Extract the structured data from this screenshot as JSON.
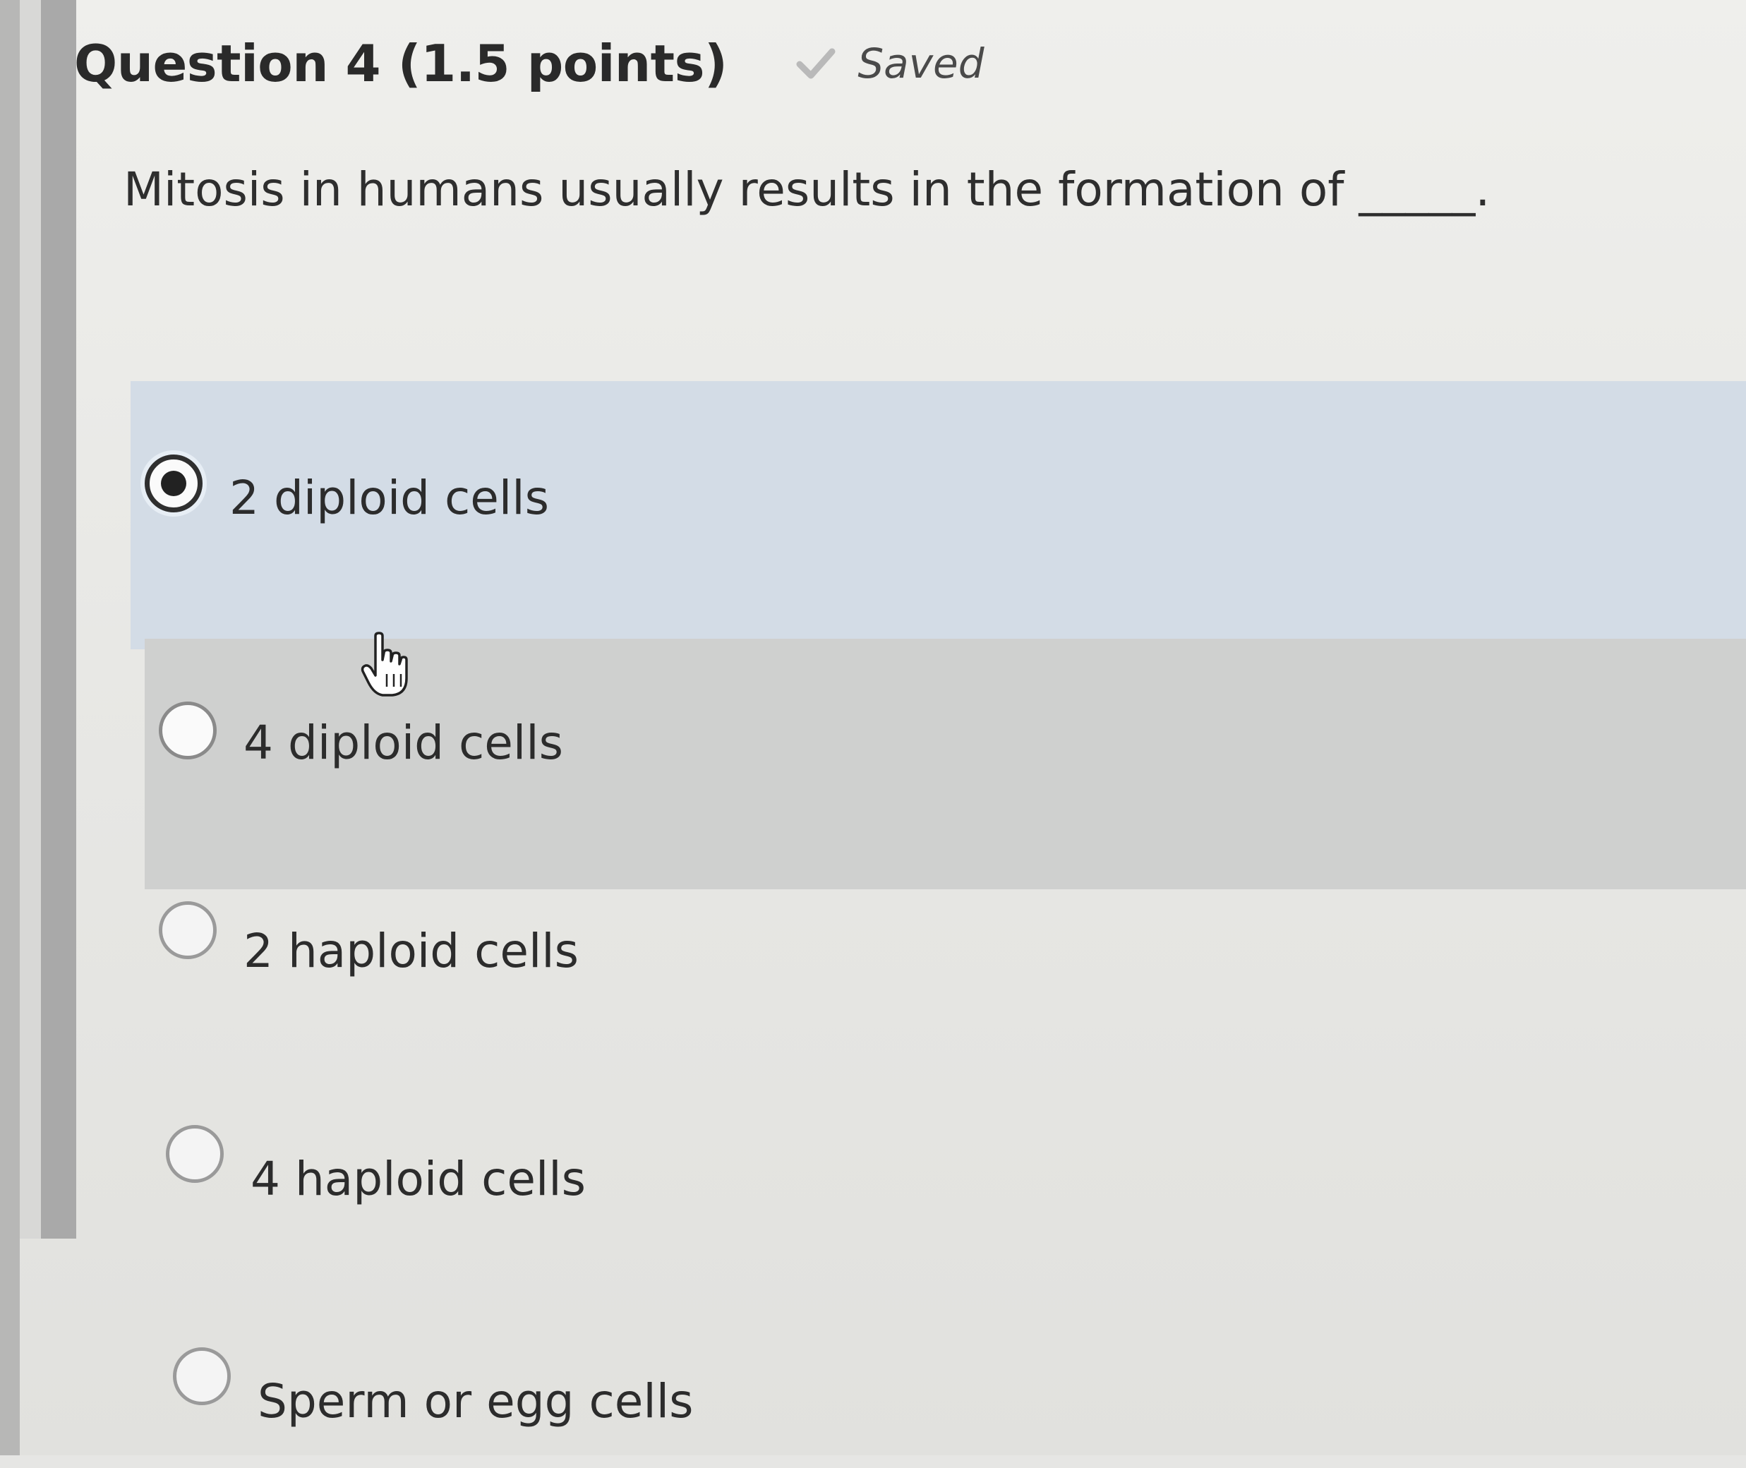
{
  "question": {
    "title": "Question 4 (1.5 points)",
    "status": "Saved",
    "prompt": "Mitosis in humans usually results in the formation of _____."
  },
  "options": [
    {
      "label": "2 diploid cells",
      "selected": true
    },
    {
      "label": "4 diploid cells",
      "selected": false
    },
    {
      "label": "2 haploid cells",
      "selected": false
    },
    {
      "label": "4 haploid cells",
      "selected": false
    },
    {
      "label": "Sperm or egg cells",
      "selected": false
    }
  ],
  "colors": {
    "selected_row": "#d3dce6",
    "hover_row": "#cfd0cf",
    "text": "#2c2c2c"
  },
  "icons": {
    "status": "check-icon",
    "cursor": "hand-pointer-icon"
  }
}
